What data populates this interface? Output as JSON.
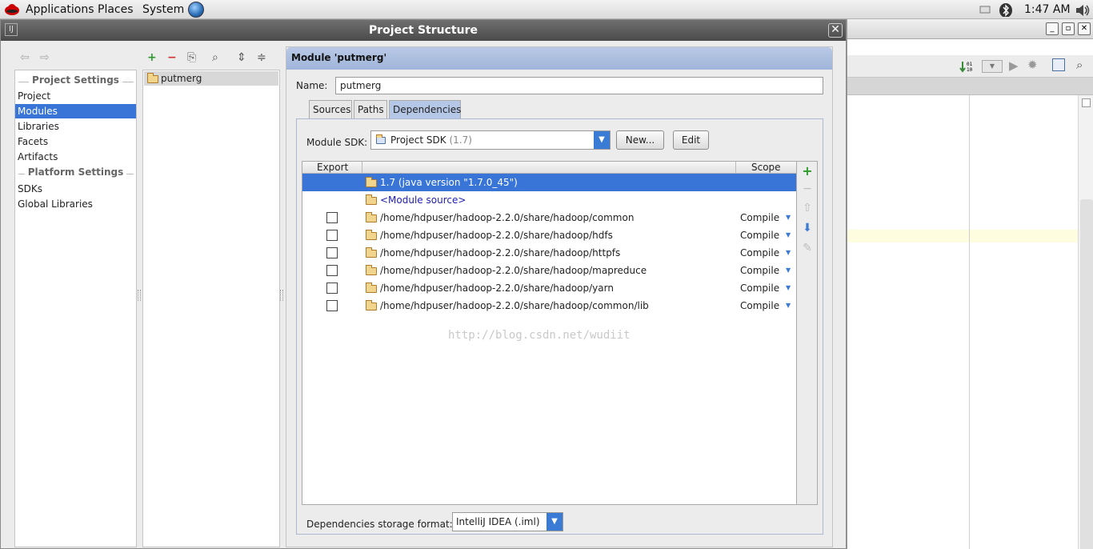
{
  "panel": {
    "menus": [
      "Applications",
      "Places",
      "System"
    ],
    "clock": "1:47 AM"
  },
  "dialog": {
    "title": "Project Structure",
    "close_label": "✕"
  },
  "nav": {
    "back_icon": "arrow-left-icon",
    "forward_icon": "arrow-right-icon"
  },
  "sidebar": {
    "group1": "Project Settings",
    "group1_items": [
      "Project",
      "Modules",
      "Libraries",
      "Facets",
      "Artifacts"
    ],
    "group2": "Platform Settings",
    "group2_items": [
      "SDKs",
      "Global Libraries"
    ],
    "selected": "Modules"
  },
  "module_list": {
    "items": [
      "putmerg"
    ]
  },
  "module": {
    "header": "Module 'putmerg'",
    "name_label": "Name:",
    "name_value": "putmerg",
    "tabs": [
      "Sources",
      "Paths",
      "Dependencies"
    ],
    "active_tab": "Dependencies",
    "sdk_label": "Module SDK:",
    "sdk_value": "Project SDK",
    "sdk_version": "(1.7)",
    "new_button": "New...",
    "edit_button": "Edit",
    "table_headers": {
      "export": "Export",
      "scope": "Scope"
    },
    "rows": [
      {
        "path": "1.7 (java version \"1.7.0_45\")",
        "scope": "",
        "checkbox": false,
        "selected": true
      },
      {
        "path": "<Module source>",
        "scope": "",
        "checkbox": false,
        "selected": false
      },
      {
        "path": "/home/hdpuser/hadoop-2.2.0/share/hadoop/common",
        "scope": "Compile",
        "checkbox": true,
        "selected": false
      },
      {
        "path": "/home/hdpuser/hadoop-2.2.0/share/hadoop/hdfs",
        "scope": "Compile",
        "checkbox": true,
        "selected": false
      },
      {
        "path": "/home/hdpuser/hadoop-2.2.0/share/hadoop/httpfs",
        "scope": "Compile",
        "checkbox": true,
        "selected": false
      },
      {
        "path": "/home/hdpuser/hadoop-2.2.0/share/hadoop/mapreduce",
        "scope": "Compile",
        "checkbox": true,
        "selected": false
      },
      {
        "path": "/home/hdpuser/hadoop-2.2.0/share/hadoop/yarn",
        "scope": "Compile",
        "checkbox": true,
        "selected": false
      },
      {
        "path": "/home/hdpuser/hadoop-2.2.0/share/hadoop/common/lib",
        "scope": "Compile",
        "checkbox": true,
        "selected": false
      }
    ],
    "watermark": "http://blog.csdn.net/wudiit",
    "storage_label": "Dependencies storage format:",
    "storage_value": "IntelliJ IDEA (.iml)"
  },
  "colors": {
    "selection": "#3875d7",
    "header_blue": "#9fb5da",
    "add_green": "#2e9a2e",
    "remove_red": "#d03030"
  }
}
